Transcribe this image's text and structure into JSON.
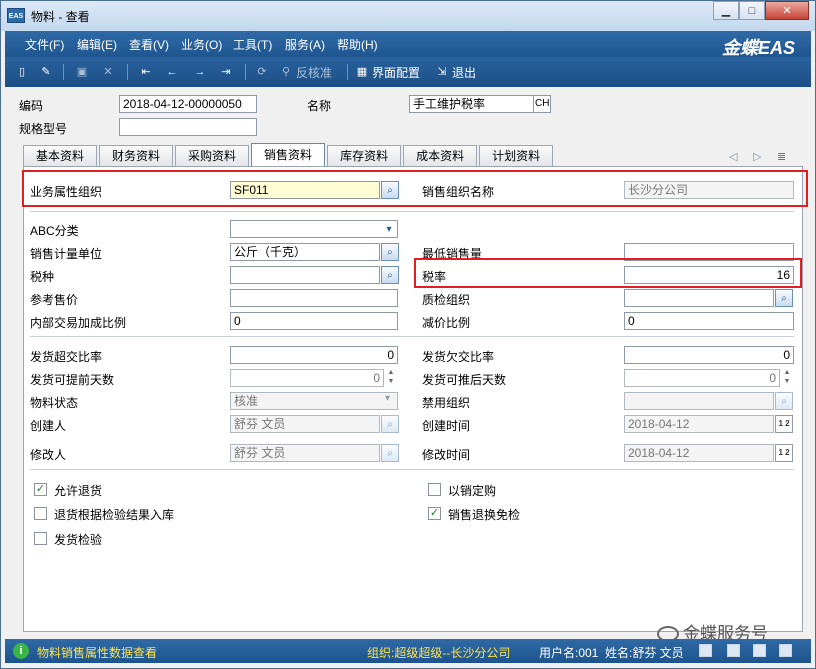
{
  "window": {
    "title": "物料 - 查看",
    "app_icon": "EAS",
    "brand": "金蝶EAS"
  },
  "menu": [
    "文件(F)",
    "编辑(E)",
    "查看(V)",
    "业务(O)",
    "工具(T)",
    "服务(A)",
    "帮助(H)"
  ],
  "toolbar": {
    "unaudit_label": "反核准",
    "ui_config_label": "界面配置",
    "exit_label": "退出",
    "icons": [
      "new-icon",
      "edit-icon",
      "save-icon",
      "delete-icon",
      "first-icon",
      "prev-icon",
      "next-icon",
      "last-icon",
      "unaudit-icon",
      "ui-config-icon",
      "exit-icon"
    ]
  },
  "header": {
    "code_label": "编码",
    "code_value": "2018-04-12-00000050",
    "name_label": "名称",
    "name_value": "手工维护税率",
    "lang_button": "CH",
    "spec_label": "规格型号",
    "spec_value": ""
  },
  "tabs": [
    "基本资料",
    "财务资料",
    "采购资料",
    "销售资料",
    "库存资料",
    "成本资料",
    "计划资料"
  ],
  "active_tab": "销售资料",
  "form": {
    "org_label": "业务属性组织",
    "org_value": "SF011",
    "org_name_label": "销售组织名称",
    "org_name_value": "长沙分公司",
    "abc_label": "ABC分类",
    "abc_value": "",
    "unit_label": "销售计量单位",
    "unit_value": "公斤（千克）",
    "min_qty_label": "最低销售量",
    "min_qty_value": "",
    "tax_type_label": "税种",
    "tax_type_value": "",
    "tax_rate_label": "税率",
    "tax_rate_value": "16",
    "ref_price_label": "参考售价",
    "ref_price_value": "",
    "qc_org_label": "质检组织",
    "qc_org_value": "",
    "markup_label": "内部交易加成比例",
    "markup_value": "0",
    "discount_label": "减价比例",
    "discount_value": "0",
    "over_ratio_label": "发货超交比率",
    "over_ratio_value": "0",
    "under_ratio_label": "发货欠交比率",
    "under_ratio_value": "0",
    "advance_days_label": "发货可提前天数",
    "advance_days_value": "0",
    "delay_days_label": "发货可推后天数",
    "delay_days_value": "0",
    "status_label": "物料状态",
    "status_value": "核准",
    "disabled_org_label": "禁用组织",
    "disabled_org_value": "",
    "creator_label": "创建人",
    "creator_value": "舒芬 文员",
    "create_time_label": "创建时间",
    "create_time_value": "2018-04-12",
    "modifier_label": "修改人",
    "modifier_value": "舒芬 文员",
    "modify_time_label": "修改时间",
    "modify_time_value": "2018-04-12",
    "cal_label": "1 2"
  },
  "checkboxes": [
    {
      "label": "允许退货",
      "checked": true
    },
    {
      "label": "退货根据检验结果入库",
      "checked": false
    },
    {
      "label": "发货检验",
      "checked": false
    },
    {
      "label": "以销定购",
      "checked": false
    },
    {
      "label": "销售退换免检",
      "checked": true
    }
  ],
  "status": {
    "message": "物料销售属性数据查看",
    "org": "组织:超级超级--长沙分公司",
    "user": "用户名:001",
    "name": "姓名:舒芬 文员"
  },
  "watermark": "金蝶服务号",
  "highlight_color": "#e02020"
}
